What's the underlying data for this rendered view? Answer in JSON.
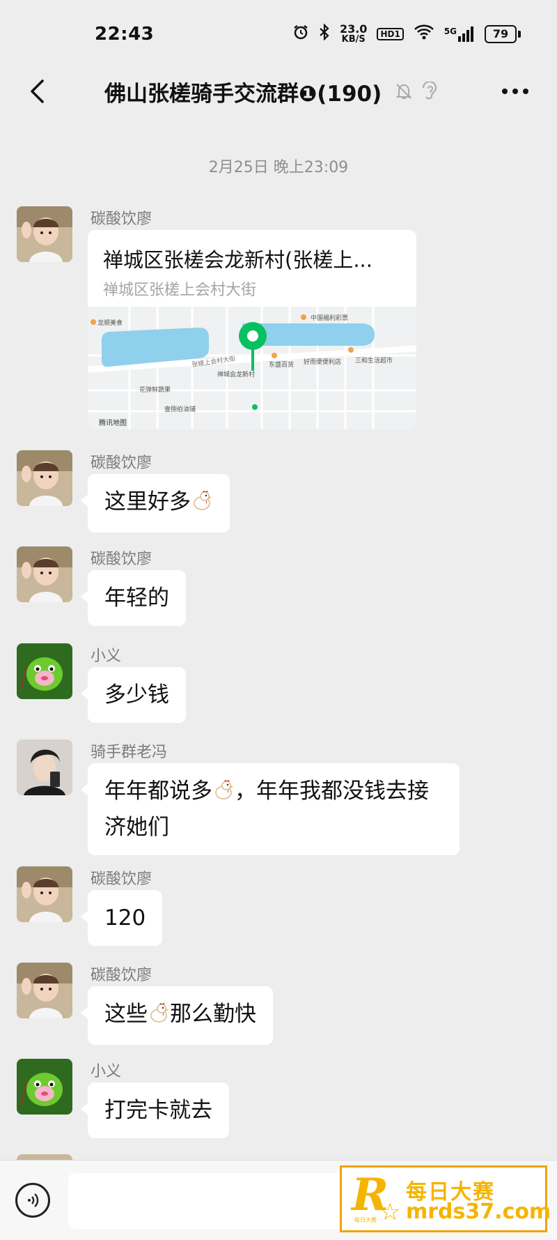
{
  "status_bar": {
    "time": "22:43",
    "net_speed_value": "23.0",
    "net_speed_unit": "KB/S",
    "hd_label": "HD1",
    "signal_label": "5G",
    "battery": "79"
  },
  "header": {
    "title": "佛山张槎骑手交流群❶(190)"
  },
  "chat": {
    "timestamp": "2月25日 晚上23:09",
    "messages": [
      {
        "sender": "碳酸饮廖",
        "type": "location",
        "location_title": "禅城区张槎会龙新村(张槎上...",
        "location_address": "禅城区张槎上会村大街"
      },
      {
        "sender": "碳酸饮廖",
        "text": "这里好多"
      },
      {
        "sender": "碳酸饮廖",
        "text": "年轻的"
      },
      {
        "sender": "小义",
        "text": "多少钱"
      },
      {
        "sender": "骑手群老冯",
        "text_a": "年年都说多",
        "text_b": "，年年我都没钱去接济她们"
      },
      {
        "sender": "碳酸饮廖",
        "text": "120"
      },
      {
        "sender": "碳酸饮廖",
        "text_a": "这些",
        "text_b": "那么勤快"
      },
      {
        "sender": "小义",
        "text": "打完卡就去"
      }
    ]
  },
  "map": {
    "labels": [
      "龙顺美食",
      "中国福利彩票",
      "张槎上会村大街",
      "东盛百货",
      "好而便便利店",
      "三和生活超市",
      "禅城会龙新村",
      "花弹鲜蔬果",
      "壹捌伯油铺",
      "腾讯地图"
    ],
    "water_color": "#8fd0ec",
    "pin_color": "#07c160"
  },
  "watermark": {
    "logo_letter": "R",
    "small_text": "每日大赛",
    "cn": "每日大赛",
    "en": "mrds37.com"
  },
  "colors": {
    "background": "#ededed",
    "bubble": "#ffffff",
    "accent": "#07c160"
  }
}
